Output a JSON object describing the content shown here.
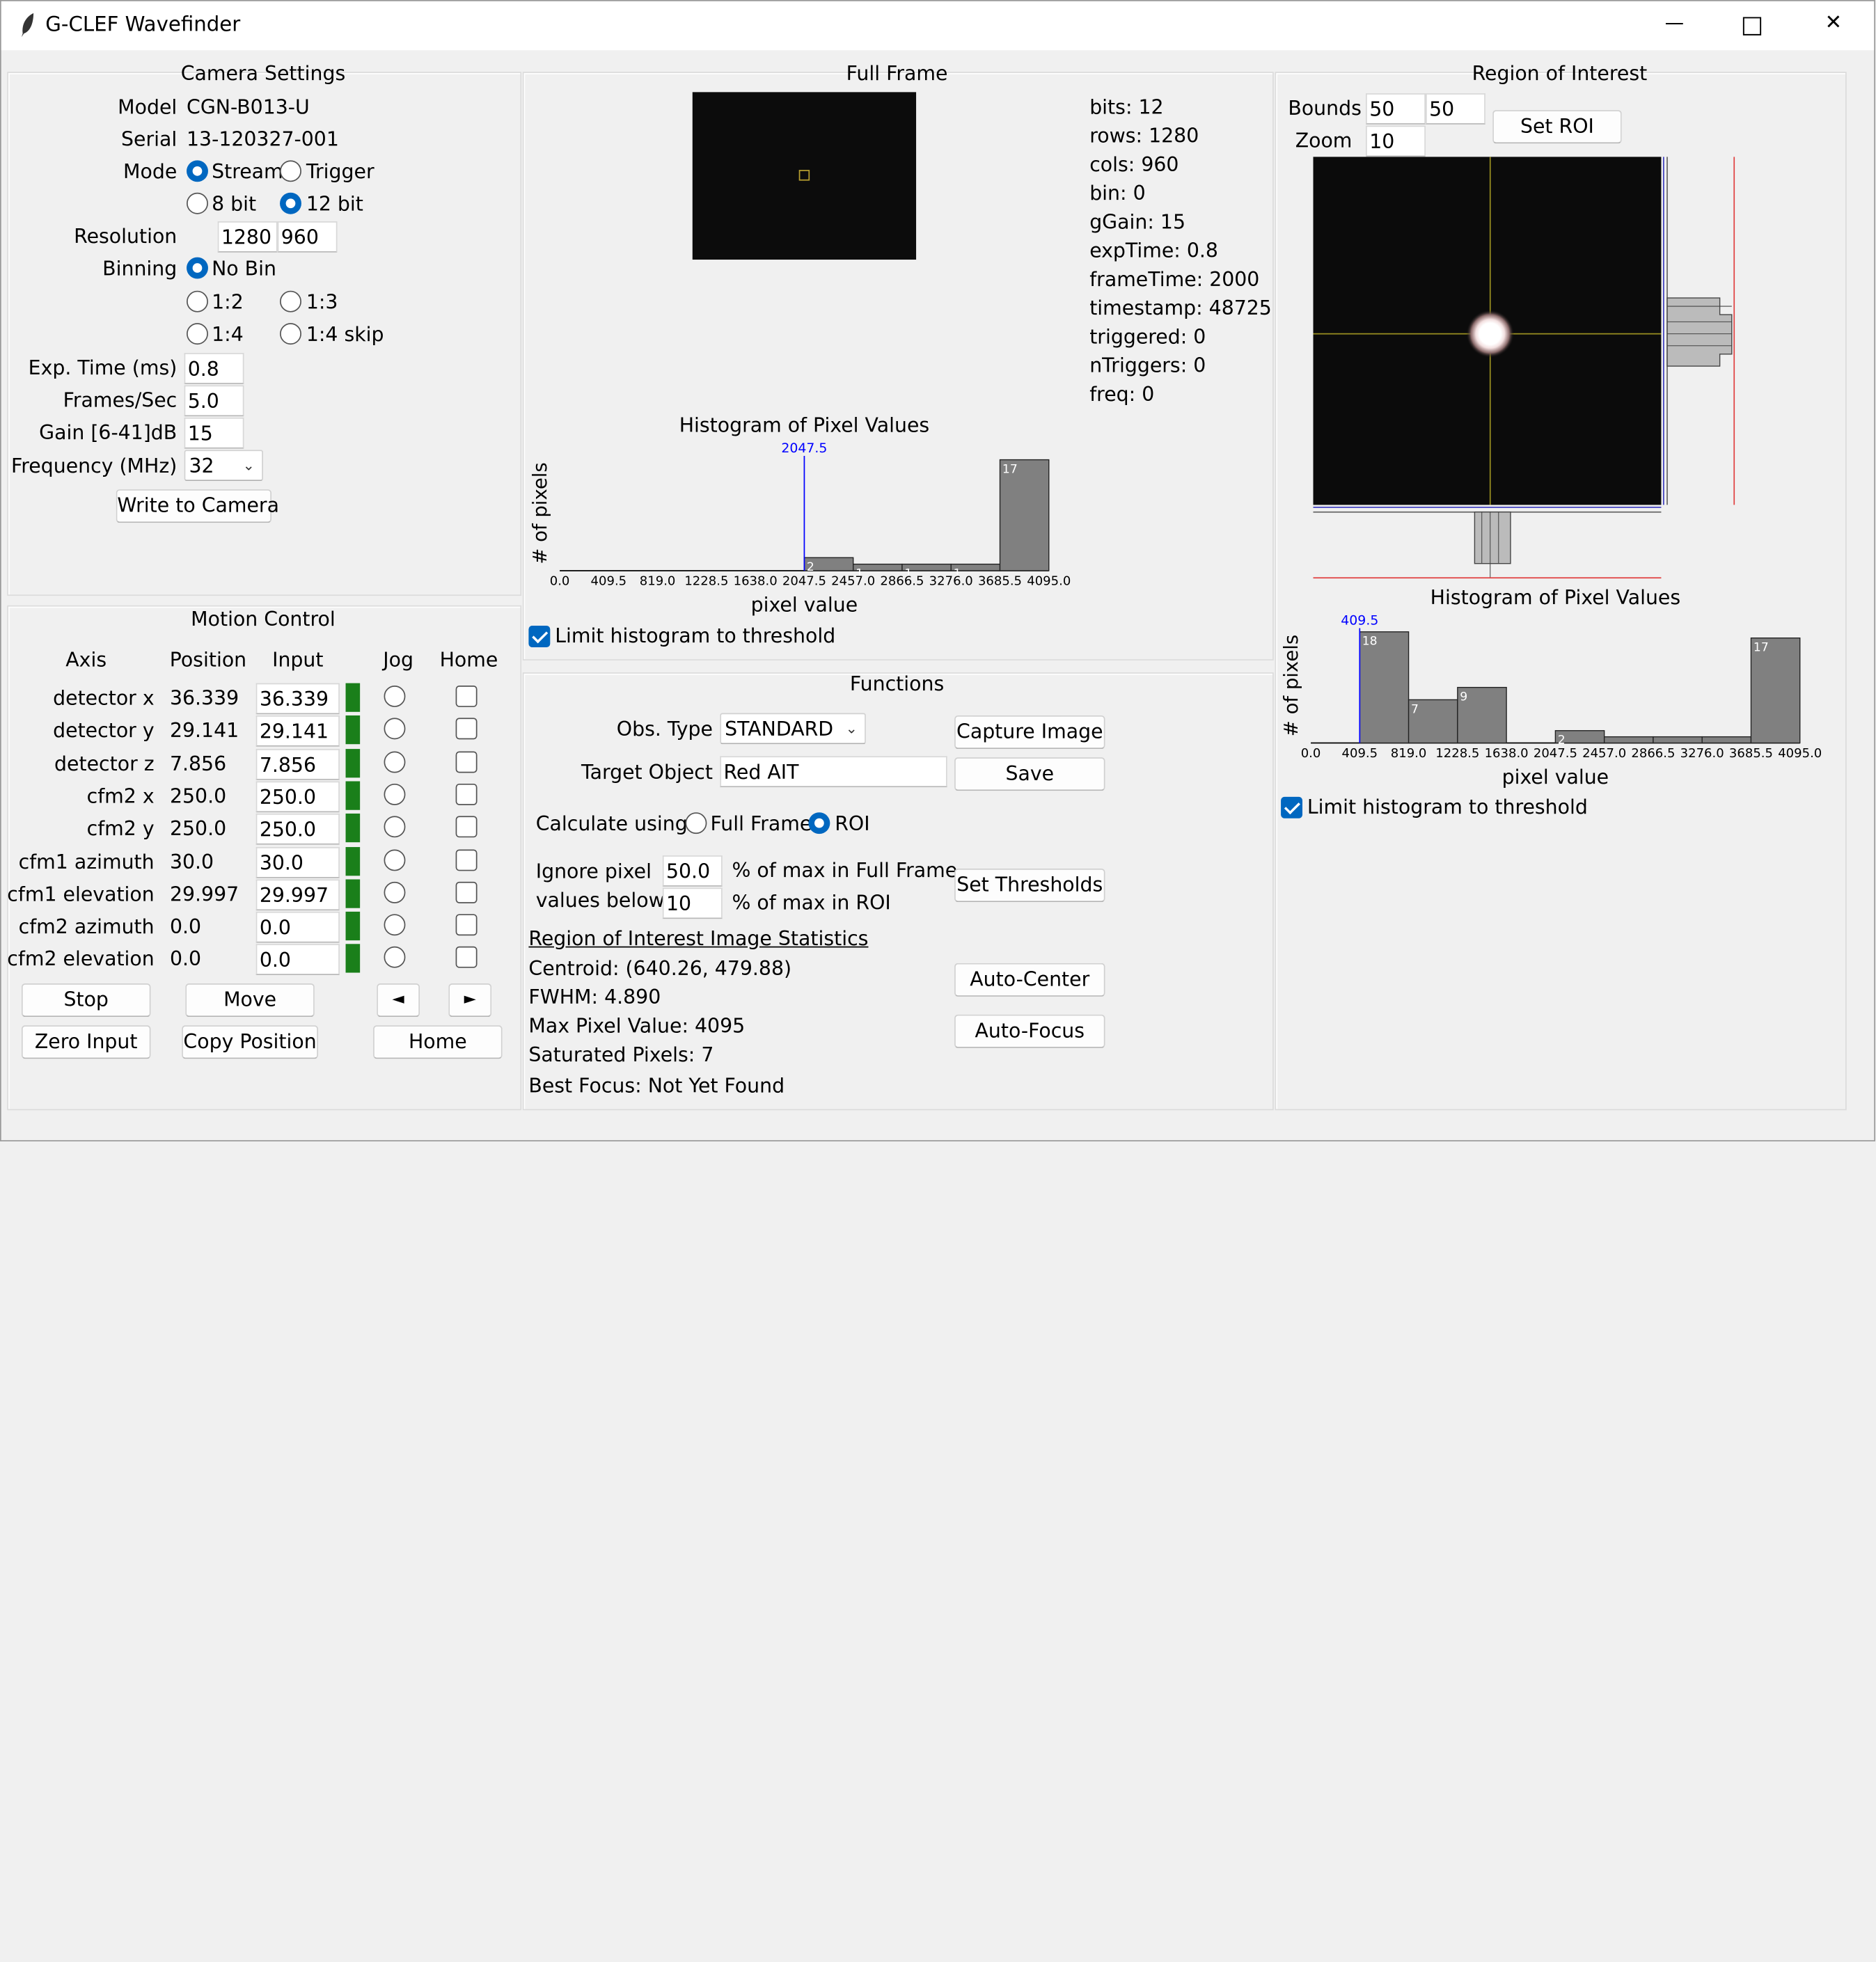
{
  "window": {
    "title": "G-CLEF Wavefinder",
    "controls": {
      "minimize": "—",
      "maximize": "□",
      "close": "✕"
    }
  },
  "camera_settings": {
    "title": "Camera Settings",
    "model_label": "Model",
    "model_value": "CGN-B013-U",
    "serial_label": "Serial",
    "serial_value": "13-120327-001",
    "mode_label": "Mode",
    "mode_stream": "Stream",
    "mode_trigger": "Trigger",
    "bit8": "8 bit",
    "bit12": "12 bit",
    "resolution_label": "Resolution",
    "res_rows": "1280",
    "res_cols": "960",
    "binning_label": "Binning",
    "bin_none": "No Bin",
    "bin_12": "1:2",
    "bin_13": "1:3",
    "bin_14": "1:4",
    "bin_14skip": "1:4 skip",
    "exp_label": "Exp. Time (ms)",
    "exp_value": "0.8",
    "fps_label": "Frames/Sec",
    "fps_value": "5.0",
    "gain_label": "Gain [6-41]dB",
    "gain_value": "15",
    "freq_label": "Frequency (MHz)",
    "freq_value": "32",
    "write_button": "Write to Camera"
  },
  "motion_control": {
    "title": "Motion Control",
    "headers": {
      "axis": "Axis",
      "position": "Position",
      "input": "Input",
      "jog": "Jog",
      "home": "Home"
    },
    "rows": [
      {
        "axis": "detector x",
        "position": "36.339",
        "input": "36.339"
      },
      {
        "axis": "detector y",
        "position": "29.141",
        "input": "29.141"
      },
      {
        "axis": "detector z",
        "position": "7.856",
        "input": "7.856"
      },
      {
        "axis": "cfm2 x",
        "position": "250.0",
        "input": "250.0"
      },
      {
        "axis": "cfm2 y",
        "position": "250.0",
        "input": "250.0"
      },
      {
        "axis": "cfm1 azimuth",
        "position": "30.0",
        "input": "30.0"
      },
      {
        "axis": "cfm1 elevation",
        "position": "29.997",
        "input": "29.997"
      },
      {
        "axis": "cfm2 azimuth",
        "position": "0.0",
        "input": "0.0"
      },
      {
        "axis": "cfm2 elevation",
        "position": "0.0",
        "input": "0.0"
      }
    ],
    "stop_button": "Stop",
    "move_button": "Move",
    "jog_left": "◄",
    "jog_right": "►",
    "zero_button": "Zero Input",
    "copy_button": "Copy Position",
    "home_button": "Home",
    "status_color": "#1a7f1a"
  },
  "full_frame": {
    "title": "Full Frame",
    "info": {
      "bits": "bits: 12",
      "rows": "rows: 1280",
      "cols": "cols: 960",
      "bin": "bin: 0",
      "gain": "gGain: 15",
      "exp": "expTime: 0.8",
      "frame": "frameTime: 2000",
      "timestamp": "timestamp: 48725",
      "triggered": "triggered: 0",
      "ntriggers": "nTriggers: 0",
      "freq": "freq: 0"
    },
    "limit_checkbox": "Limit histogram to threshold"
  },
  "functions": {
    "title": "Functions",
    "obs_label": "Obs. Type",
    "obs_value": "STANDARD",
    "target_label": "Target Object",
    "target_value": "Red AIT",
    "capture_button": "Capture Image",
    "save_button": "Save",
    "calc_label": "Calculate using",
    "calc_full": "Full Frame",
    "calc_roi": "ROI",
    "ignore_label1": "Ignore pixel",
    "ignore_label2": "values below",
    "ignore_full_value": "50.0",
    "ignore_roi_value": "10",
    "full_suffix": "% of max in Full Frame",
    "roi_suffix": "% of max in ROI",
    "thresholds_button": "Set Thresholds",
    "stats_title": "Region of Interest Image Statistics",
    "centroid": "Centroid: (640.26, 479.88)",
    "fwhm": "FWHM: 4.890",
    "max_pixel": "Max Pixel Value: 4095",
    "saturated": "Saturated Pixels: 7",
    "best_focus": "Best Focus: Not Yet Found",
    "autocenter_button": "Auto-Center",
    "autofocus_button": "Auto-Focus"
  },
  "roi": {
    "title": "Region of Interest",
    "bounds_label": "Bounds",
    "bounds_x": "50",
    "bounds_y": "50",
    "zoom_label": "Zoom",
    "zoom_value": "10",
    "set_button": "Set ROI",
    "limit_checkbox": "Limit histogram to threshold"
  },
  "chart_data": [
    {
      "type": "bar",
      "title": "Histogram of Pixel Values",
      "xlabel": "pixel value",
      "ylabel": "# of pixels",
      "tick_labels": [
        "0.0",
        "409.5",
        "819.0",
        "1228.5",
        "1638.0",
        "2047.5",
        "2457.0",
        "2866.5",
        "3276.0",
        "3685.5",
        "4095.0"
      ],
      "bins": [
        "2047.5-2457.0",
        "2457.0-2866.5",
        "2866.5-3276.0",
        "3276.0-3685.5",
        "3685.5-4095.0"
      ],
      "values": [
        2,
        1,
        1,
        1,
        17
      ],
      "value_labels": [
        "2",
        "1",
        "1",
        "1",
        "17"
      ],
      "threshold": 2047.5,
      "threshold_label": "2047.5",
      "threshold_color": "#0000ff",
      "bar_color": "#808080"
    },
    {
      "type": "bar",
      "title": "Histogram of Pixel Values",
      "xlabel": "pixel value",
      "ylabel": "# of pixels",
      "tick_labels": [
        "0.0",
        "409.5",
        "819.0",
        "1228.5",
        "1638.0",
        "2047.5",
        "2457.0",
        "2866.5",
        "3276.0",
        "3685.5",
        "4095.0"
      ],
      "bins": [
        "409.5-819.0",
        "819.0-1228.5",
        "1228.5-1638.0",
        "2047.5-2457.0",
        "2457.0-2866.5",
        "2866.5-3276.0",
        "3276.0-3685.5",
        "3685.5-4095.0"
      ],
      "values": [
        18,
        7,
        9,
        2,
        1,
        1,
        1,
        17
      ],
      "value_labels": [
        "18",
        "7",
        "9",
        "2",
        "",
        "",
        "",
        "17"
      ],
      "threshold": 409.5,
      "threshold_label": "409.5",
      "threshold_color": "#0000ff",
      "bar_color": "#808080"
    }
  ]
}
